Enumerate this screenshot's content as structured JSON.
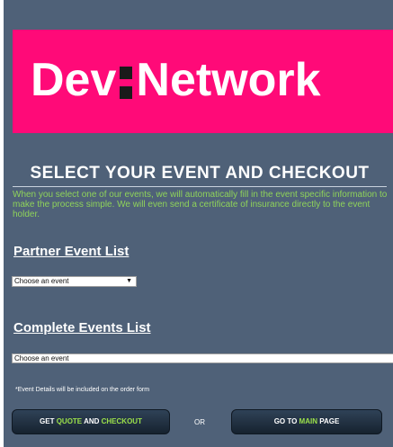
{
  "logo": {
    "left_text": "Dev",
    "right_text": "Network",
    "brand_color": "#ff0a78"
  },
  "heading": "SELECT YOUR EVENT AND CHECKOUT",
  "intro": "When you select one of our events, we will automatically fill in the event specific information to make the process simple. We will even send a certificate of insurance directly to the event holder.",
  "partner_section": {
    "title": "Partner Event List",
    "select_value": "Choose an event",
    "arrow": "▼"
  },
  "complete_section": {
    "title": "Complete Events List",
    "select_value": "Choose an event"
  },
  "note": "*Event Details will be included on the order form",
  "buttons": {
    "quote": {
      "part1": "GET ",
      "part2": "QUOTE",
      "part3": " AND ",
      "part4": "CHECKOUT"
    },
    "or": "OR",
    "main": {
      "part1": "GO TO ",
      "part2": "MAIN",
      "part3": " PAGE"
    }
  },
  "colors": {
    "panel": "#4f6178",
    "intro_text": "#8fd35a",
    "button_highlight": "#9be04a"
  }
}
